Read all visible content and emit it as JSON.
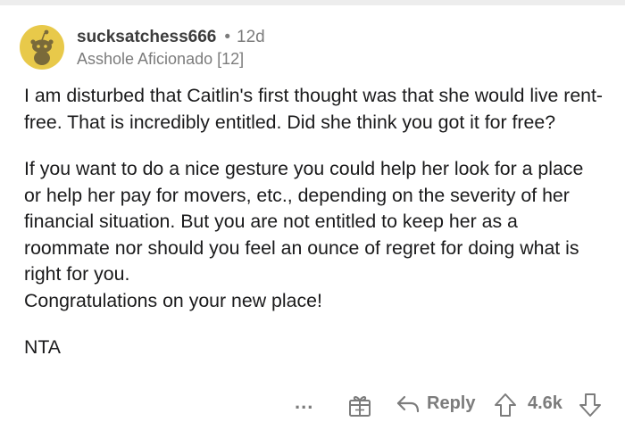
{
  "comment": {
    "author": "sucksatchess666",
    "separator": "•",
    "age": "12d",
    "flair": "Asshole Aficionado [12]",
    "paragraphs": [
      "I am disturbed that Caitlin's first thought was that she would live rent-free. That is incredibly entitled. Did she think you got it for free?",
      "If you want to do a nice gesture you could help her look for a place or help her pay for movers, etc., depending on the severity of her financial situation. But you are not entitled to keep her as a roommate nor should you feel an ounce of regret for doing what is right for you.\nCongratulations on your new place!",
      "NTA"
    ]
  },
  "actions": {
    "more_label": "...",
    "reply_label": "Reply",
    "score": "4.6k"
  },
  "icons": {
    "avatar": "snoo-avatar-icon",
    "more": "more-options-icon",
    "gift": "gift-award-icon",
    "reply": "reply-arrow-icon",
    "upvote": "upvote-arrow-icon",
    "downvote": "downvote-arrow-icon"
  },
  "colors": {
    "avatar_bg": "#e8c94a",
    "snoo": "#7a6a3a",
    "meta_text": "#7c7c7c",
    "body_text": "#1a1a1b"
  }
}
